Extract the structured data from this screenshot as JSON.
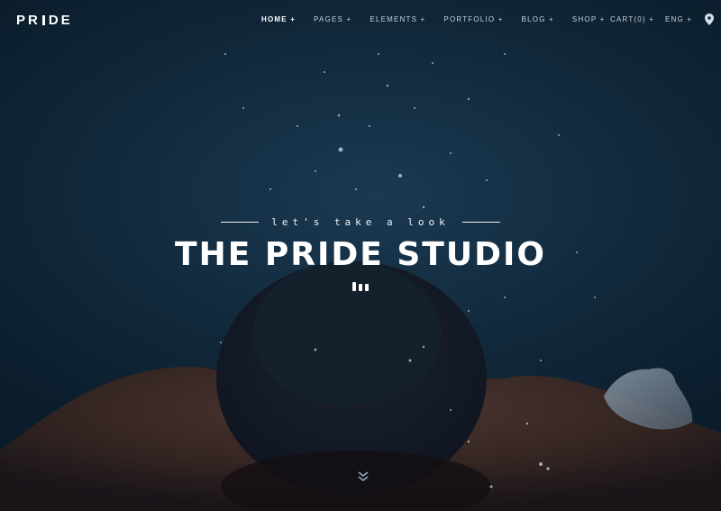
{
  "brand": {
    "logo_text_left": "PR",
    "logo_text_right": "DE"
  },
  "nav": {
    "items": [
      {
        "label": "HOME +",
        "active": true
      },
      {
        "label": "PAGES +",
        "active": false
      },
      {
        "label": "ELEMENTS +",
        "active": false
      },
      {
        "label": "PORTFOLIO +",
        "active": false
      },
      {
        "label": "BLOG +",
        "active": false
      },
      {
        "label": "SHOP +",
        "active": false
      }
    ],
    "cart": "CART(0) +",
    "language": "ENG +",
    "location_icon": "map-pin-icon"
  },
  "hero": {
    "tagline": "let's take a look",
    "title": "THE PRIDE STUDIO",
    "scroll_icon": "double-chevron-down-icon"
  },
  "colors": {
    "background": "#0b1d2b",
    "text": "#ffffff",
    "nav_text": "#c9d3dc"
  }
}
